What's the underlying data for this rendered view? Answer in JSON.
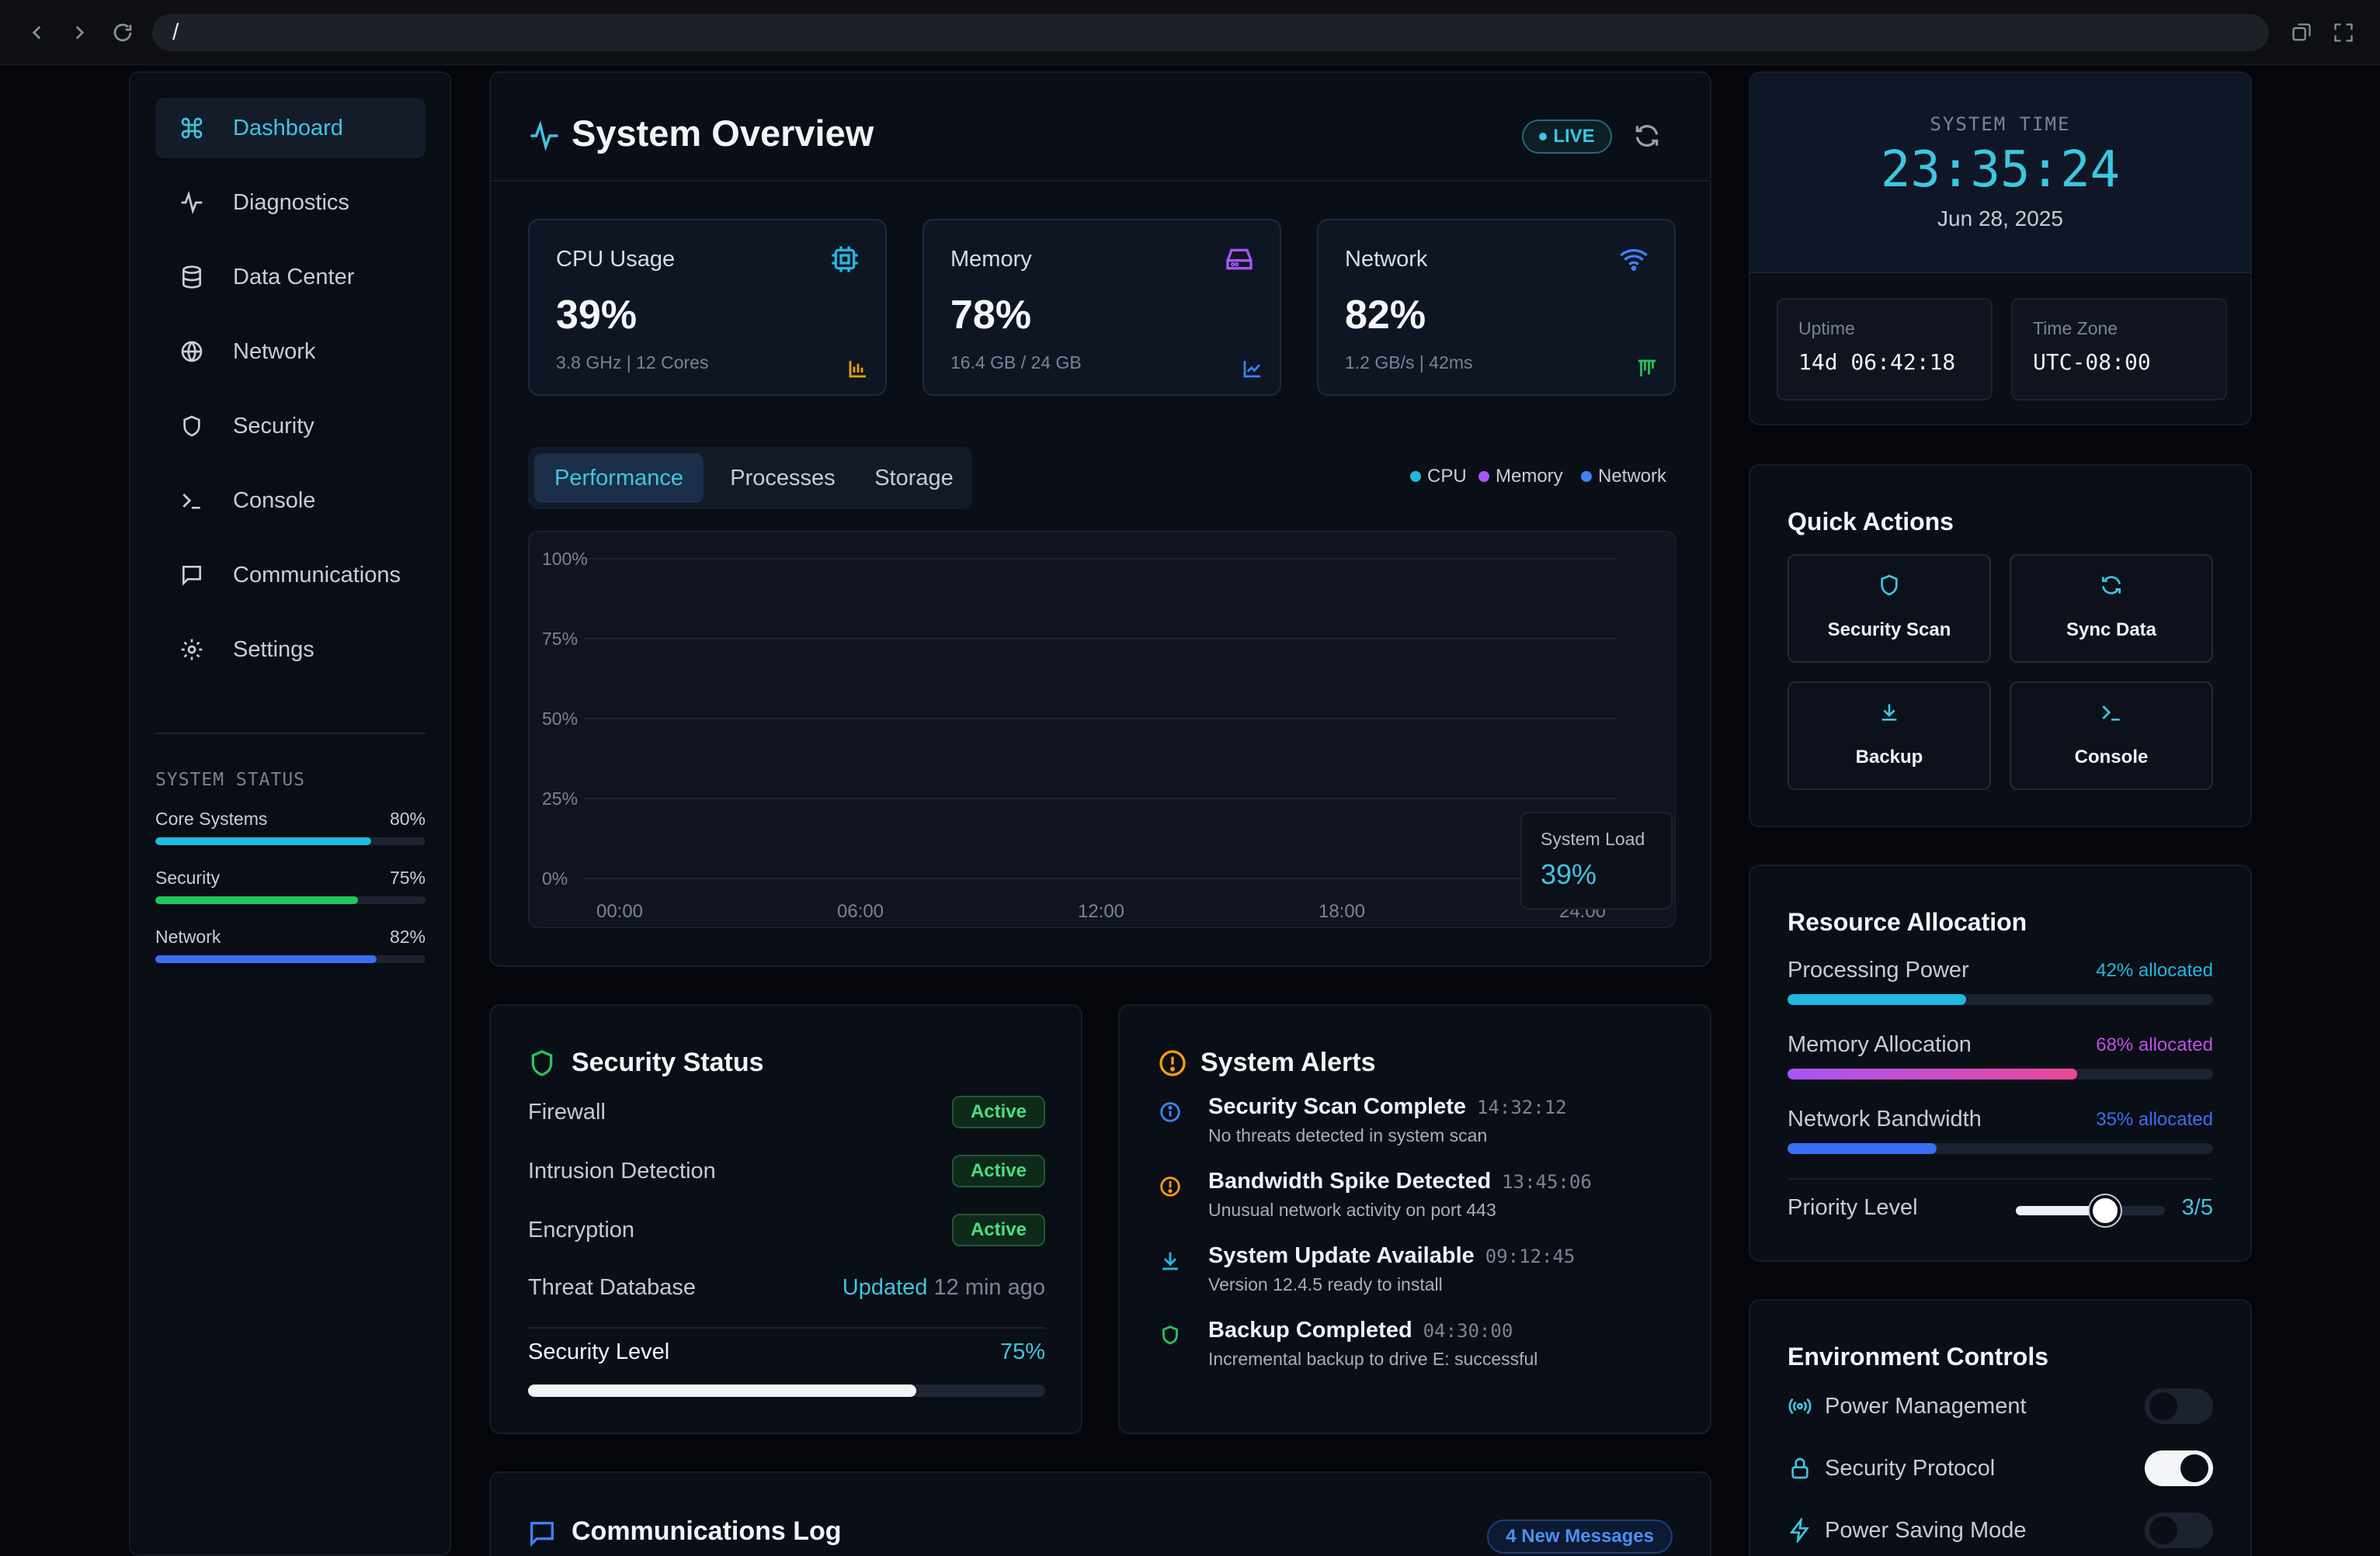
{
  "browser": {
    "url": "/"
  },
  "sidebar": {
    "items": [
      {
        "label": "Dashboard",
        "icon": "command-icon"
      },
      {
        "label": "Diagnostics",
        "icon": "activity-icon"
      },
      {
        "label": "Data Center",
        "icon": "database-icon"
      },
      {
        "label": "Network",
        "icon": "globe-icon"
      },
      {
        "label": "Security",
        "icon": "shield-icon"
      },
      {
        "label": "Console",
        "icon": "terminal-icon"
      },
      {
        "label": "Communications",
        "icon": "message-icon"
      },
      {
        "label": "Settings",
        "icon": "gear-icon"
      }
    ],
    "status_title": "SYSTEM STATUS",
    "status": [
      {
        "label": "Core Systems",
        "value": "80%",
        "pct": 80,
        "color": "#22b8e0"
      },
      {
        "label": "Security",
        "value": "75%",
        "pct": 75,
        "color": "#22c55e"
      },
      {
        "label": "Network",
        "value": "82%",
        "pct": 82,
        "color": "#3b6ef5"
      }
    ]
  },
  "overview": {
    "title": "System Overview",
    "live": "LIVE",
    "metrics": [
      {
        "label": "CPU Usage",
        "value": "39%",
        "sub": "3.8 GHz | 12 Cores",
        "color": "#22b8e0",
        "icon": "cpu-icon"
      },
      {
        "label": "Memory",
        "value": "78%",
        "sub": "16.4 GB / 24 GB",
        "color": "#a855f7",
        "icon": "hard-drive-icon"
      },
      {
        "label": "Network",
        "value": "82%",
        "sub": "1.2 GB/s | 42ms",
        "color": "#3b82f6",
        "icon": "wifi-icon"
      }
    ],
    "tabs": [
      "Performance",
      "Processes",
      "Storage"
    ],
    "legend": [
      {
        "label": "CPU",
        "color": "#22b8e0"
      },
      {
        "label": "Memory",
        "color": "#a855f7"
      },
      {
        "label": "Network",
        "color": "#3b82f6"
      }
    ],
    "system_load_label": "System Load",
    "system_load_value": "39%"
  },
  "chart_data": {
    "type": "line",
    "y_ticks": [
      "100%",
      "75%",
      "50%",
      "25%",
      "0%"
    ],
    "x_ticks": [
      "00:00",
      "06:00",
      "12:00",
      "18:00",
      "24:00"
    ],
    "ylim": [
      0,
      100
    ],
    "series": []
  },
  "security": {
    "title": "Security Status",
    "rows": [
      {
        "label": "Firewall",
        "status": "Active"
      },
      {
        "label": "Intrusion Detection",
        "status": "Active"
      },
      {
        "label": "Encryption",
        "status": "Active"
      }
    ],
    "threat_label": "Threat Database",
    "threat_status": "Updated",
    "threat_time": "12 min ago",
    "level_label": "Security Level",
    "level_value": "75%",
    "level_pct": 75
  },
  "alerts": {
    "title": "System Alerts",
    "items": [
      {
        "title": "Security Scan Complete",
        "time": "14:32:12",
        "desc": "No threats detected in system scan",
        "color": "#3b82f6",
        "icon": "info-icon"
      },
      {
        "title": "Bandwidth Spike Detected",
        "time": "13:45:06",
        "desc": "Unusual network activity on port 443",
        "color": "#f59e0b",
        "icon": "warning-icon"
      },
      {
        "title": "System Update Available",
        "time": "09:12:45",
        "desc": "Version 12.4.5 ready to install",
        "color": "#22b8e0",
        "icon": "download-icon"
      },
      {
        "title": "Backup Completed",
        "time": "04:30:00",
        "desc": "Incremental backup to drive E: successful",
        "color": "#22c55e",
        "icon": "shield-check-icon"
      }
    ]
  },
  "comms": {
    "title": "Communications Log",
    "badge": "4 New Messages"
  },
  "clock": {
    "label": "SYSTEM TIME",
    "time": "23:35:24",
    "date": "Jun 28, 2025",
    "uptime_label": "Uptime",
    "uptime": "14d 06:42:18",
    "tz_label": "Time Zone",
    "tz": "UTC-08:00"
  },
  "quick": {
    "title": "Quick Actions",
    "actions": [
      {
        "label": "Security Scan",
        "icon": "shield-icon"
      },
      {
        "label": "Sync Data",
        "icon": "refresh-icon"
      },
      {
        "label": "Backup",
        "icon": "download-icon"
      },
      {
        "label": "Console",
        "icon": "terminal-icon"
      }
    ]
  },
  "resource": {
    "title": "Resource Allocation",
    "rows": [
      {
        "label": "Processing Power",
        "value": "42% allocated",
        "pct": 42,
        "color": "#22b8e0"
      },
      {
        "label": "Memory Allocation",
        "value": "68% allocated",
        "pct": 68,
        "color": "#c050e8"
      },
      {
        "label": "Network Bandwidth",
        "value": "35% allocated",
        "pct": 35,
        "color": "#3b6ef5"
      }
    ],
    "priority_label": "Priority Level",
    "priority_value": "3/5",
    "priority_level": 3,
    "priority_max": 5
  },
  "env": {
    "title": "Environment Controls",
    "rows": [
      {
        "label": "Power Management",
        "on": false,
        "icon": "radio-icon"
      },
      {
        "label": "Security Protocol",
        "on": true,
        "icon": "lock-icon"
      },
      {
        "label": "Power Saving Mode",
        "on": false,
        "icon": "zap-icon"
      }
    ]
  }
}
